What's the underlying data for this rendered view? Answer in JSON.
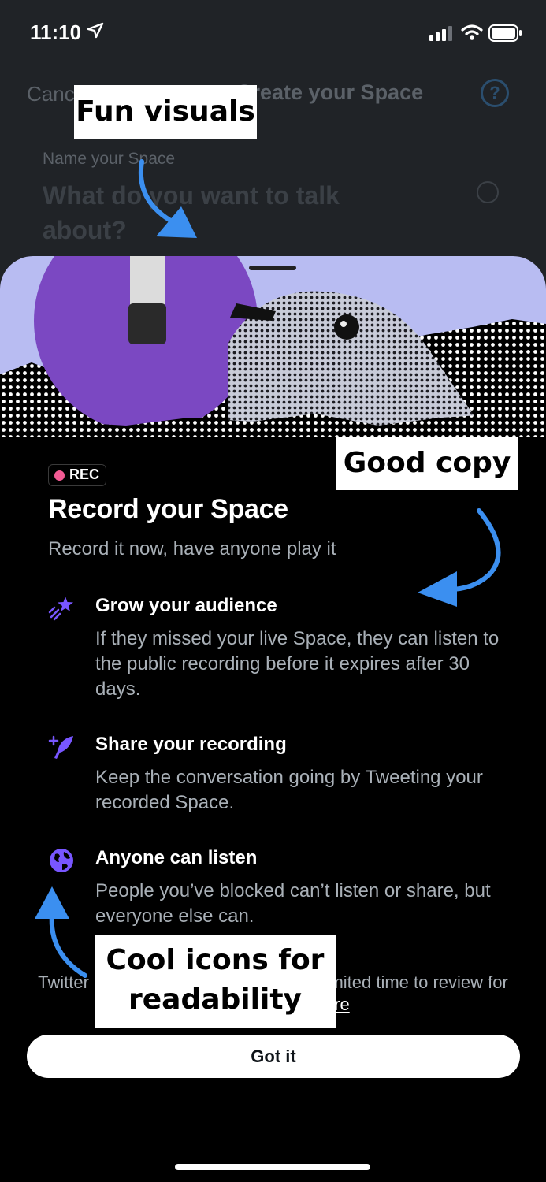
{
  "status_bar": {
    "time": "11:10"
  },
  "composer": {
    "cancel_label": "Cancel",
    "title": "Create your Space",
    "name_label": "Name your Space",
    "name_placeholder": "What do you want to talk about?"
  },
  "sheet": {
    "badge": "REC",
    "headline": "Record your Space",
    "subtitle": "Record it now, have anyone play it",
    "features": [
      {
        "icon": "sparkle-icon",
        "title": "Grow your audience",
        "description": "If they missed your live Space, they can listen to the public recording before it expires after 30 days."
      },
      {
        "icon": "feather-plus-icon",
        "title": "Share your recording",
        "description": "Keep the conversation going by Tweeting your recorded Space."
      },
      {
        "icon": "globe-icon",
        "title": "Anyone can listen",
        "description": "People you’ve blocked can’t listen or share, but everyone else can."
      }
    ],
    "footnote_text": "Twitter keeps copies of Spaces for a limited time to review for misuse. ",
    "learn_more": "Learn more",
    "button_label": "Got it"
  },
  "annotations": {
    "visuals": "Fun visuals",
    "copy": "Good copy",
    "icons": "Cool icons for readability"
  },
  "colors": {
    "accent_purple": "#7856ff",
    "rec_dot": "#f25a93",
    "annotation_arrow": "#3b8ff0",
    "hero_lavender": "#b8bcf2"
  }
}
